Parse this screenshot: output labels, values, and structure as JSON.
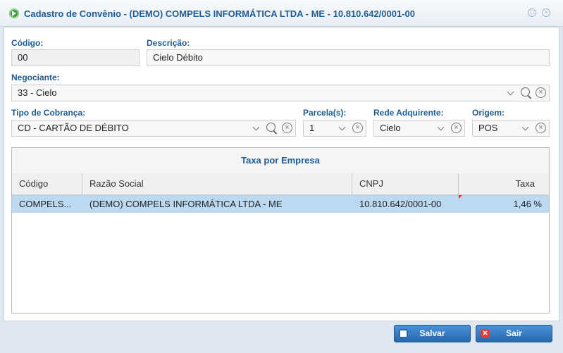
{
  "window": {
    "title": "Cadastro de Convênio - (DEMO) COMPELS INFORMÁTICA LTDA - ME - 10.810.642/0001-00"
  },
  "form": {
    "codigo": {
      "label": "Código:",
      "value": "00"
    },
    "descricao": {
      "label": "Descrição:",
      "value": "Cielo Débito"
    },
    "negociante": {
      "label": "Negociante:",
      "value": "33 - Cielo"
    },
    "tipo_cobranca": {
      "label": "Tipo de Cobrança:",
      "value": "CD - CARTÃO DE DÉBITO"
    },
    "parcelas": {
      "label": "Parcela(s):",
      "value": "1"
    },
    "rede_adquirente": {
      "label": "Rede Adquirente:",
      "value": "Cielo"
    },
    "origem": {
      "label": "Origem:",
      "value": "POS"
    }
  },
  "grid": {
    "caption": "Taxa por Empresa",
    "columns": [
      "Código",
      "Razão Social",
      "CNPJ",
      "Taxa"
    ],
    "rows": [
      {
        "codigo": "COMPELS...",
        "razao_social": "(DEMO) COMPELS INFORMÁTICA LTDA - ME",
        "cnpj": "10.810.642/0001-00",
        "taxa": "1,46 %"
      }
    ]
  },
  "buttons": {
    "save": "Salvar",
    "exit": "Sair"
  },
  "icons": {
    "app": "play-circle-icon",
    "maximize": "restore-icon",
    "close": "close-icon",
    "search": "search-icon",
    "clear": "clear-icon",
    "dropdown": "chevron-down-icon",
    "save": "floppy-icon",
    "exit": "cancel-icon"
  },
  "colors": {
    "accent": "#1f5c93",
    "selected_row": "#bcd9f2",
    "button": "#2468ae"
  }
}
